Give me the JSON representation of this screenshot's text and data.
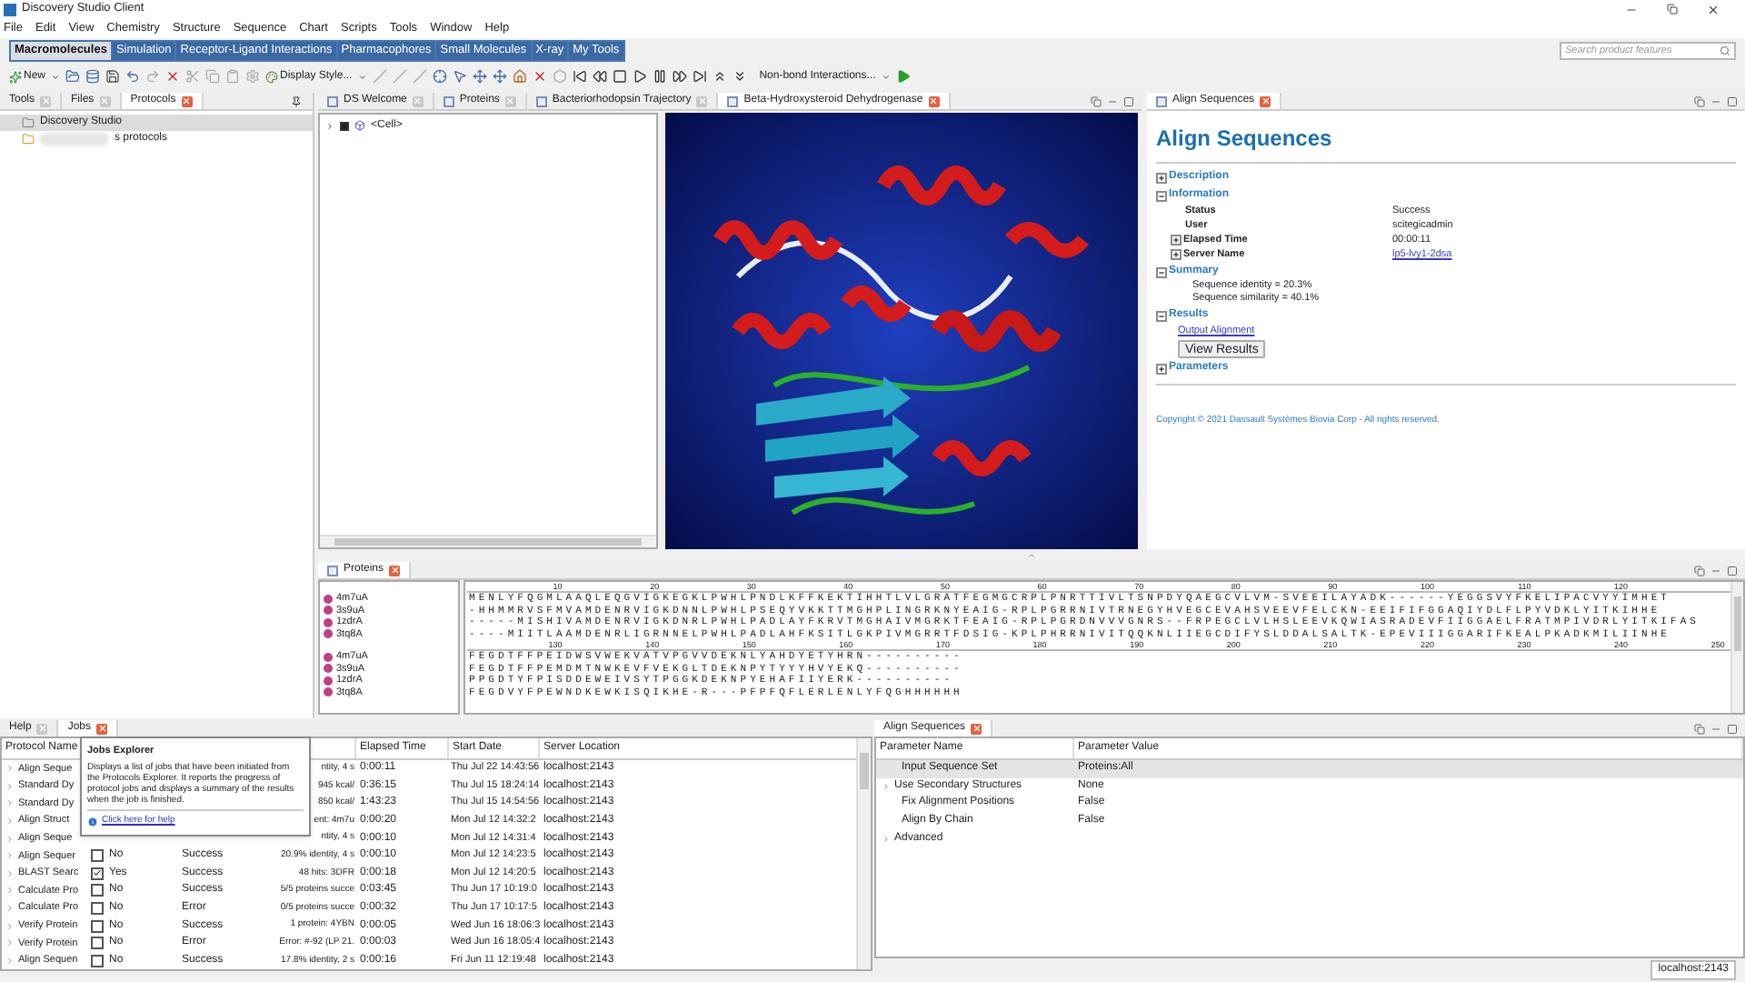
{
  "window": {
    "title": "Discovery Studio Client"
  },
  "menu": [
    "File",
    "Edit",
    "View",
    "Chemistry",
    "Structure",
    "Sequence",
    "Chart",
    "Scripts",
    "Tools",
    "Window",
    "Help"
  ],
  "ribbon_tabs": [
    {
      "label": "Macromolecules",
      "selected": true
    },
    {
      "label": "Simulation",
      "selected": false
    },
    {
      "label": "Receptor-Ligand Interactions",
      "selected": false
    },
    {
      "label": "Pharmacophores",
      "selected": false
    },
    {
      "label": "Small Molecules",
      "selected": false
    },
    {
      "label": "X-ray",
      "selected": false
    },
    {
      "label": "My Tools",
      "selected": false
    }
  ],
  "search": {
    "placeholder": "Search product features"
  },
  "toolbar": {
    "new_label": "New",
    "display_style": "Display Style...",
    "interactions": "Non-bond Interactions..."
  },
  "left_tabs": [
    {
      "label": "Tools",
      "selected": false
    },
    {
      "label": "Files",
      "selected": false
    },
    {
      "label": "Protocols",
      "selected": true
    }
  ],
  "protocol_tree": [
    {
      "label": "Discovery Studio",
      "selected": true,
      "redacted": false
    },
    {
      "label": "s protocols",
      "selected": false,
      "redacted": true
    }
  ],
  "doc_tabs": [
    {
      "label": "DS Welcome",
      "selected": false
    },
    {
      "label": "Proteins",
      "selected": false
    },
    {
      "label": "Bacteriorhodopsin Trajectory",
      "selected": false
    },
    {
      "label": "Beta-Hydroxysteroid Dehydrogenase",
      "selected": true
    }
  ],
  "hierarchy": [
    {
      "label": "<Cell>",
      "expanded": false,
      "visible": true
    }
  ],
  "report_tab": {
    "label": "Align Sequences",
    "selected": true
  },
  "report": {
    "title": "Align Sequences",
    "sections": [
      {
        "label": "Description",
        "expanded": false
      },
      {
        "label": "Information",
        "expanded": true,
        "kind": "fields",
        "fields": [
          {
            "label": "Status",
            "value": "Success",
            "expandable": false,
            "link": false
          },
          {
            "label": "User",
            "value": "scitegicadmin",
            "expandable": false,
            "link": false
          },
          {
            "label": "Elapsed Time",
            "value": "00:00:11",
            "expandable": true,
            "link": false
          },
          {
            "label": "Server Name",
            "value": "lp5-lvy1-2dsa",
            "expandable": true,
            "link": true
          }
        ]
      },
      {
        "label": "Summary",
        "expanded": true,
        "kind": "lines",
        "lines": [
          "Sequence identity = 20.3%",
          "Sequence similarity = 40.1%"
        ]
      },
      {
        "label": "Results",
        "expanded": true,
        "kind": "actions",
        "link": "Output Alignment",
        "button": "View Results"
      },
      {
        "label": "Parameters",
        "expanded": false
      }
    ],
    "copyright": "Copyright © 2021 Dassault Systèmes Biovia Corp - All rights reserved."
  },
  "sequence_panel": {
    "tab": {
      "label": "Proteins",
      "selected": true
    },
    "blocks": [
      {
        "ruler": [
          "10",
          "20",
          "30",
          "40",
          "50",
          "60",
          "70",
          "80",
          "90",
          "100",
          "110",
          "120"
        ],
        "rows": [
          {
            "name": "4m7uA",
            "sequence": "MENLYFQGMLAAQLEQGVIGKEGKLPWHLPNDLKFFKEKTIHHTLVLGRATFEGMGCRPLPNRTTIVLTSNPDYQAEGCVLVM-SVEEILAYADK------YEGGSVYFKELIPACVYYIMHET"
          },
          {
            "name": "3s9uA",
            "sequence": "-HHMMRVSFMVAMDENRVIGKDNNLPWHLPSEQYVKKTTMGHPLINGRKNYEAIG-RPLPGRRNIVTRNEGYHVEGCEVAHSVEEVFELCKN-EEIFIFGGAQIYDLFLPYVDKLYITKIHHE"
          },
          {
            "name": "1zdrA",
            "sequence": "-----MISHIVAMDENRVIGKDNRLPWHLPADLAYFKRVTMGHAIVMGRKTFEAIG-RPLPGRDNVVVGNRS--FRPEGCLVLHSLEEVKQWIASRADEVFIIGGAELFRATMPIVDRLYITKIFAS"
          },
          {
            "name": "3tq8A",
            "sequence": "----MIITLAAMDENRLIGRNNELPWHLPADLAHFKSITLGKPIVMGRRTFDSIG-KPLPHRRNIVITQQKNLIIEGCDIFYSLDDALSALTK-EPEVIIIGGARIFKEALPKADKMILIINHE"
          }
        ]
      },
      {
        "ruler": [
          "130",
          "140",
          "150",
          "160",
          "170",
          "180",
          "190",
          "200",
          "210",
          "220",
          "230",
          "240",
          "250"
        ],
        "rows": [
          {
            "name": "4m7uA",
            "sequence": "FEGDTFFPEIDWSVWEKVATVPGVVDEKNLYAHDYETYHRN----------"
          },
          {
            "name": "3s9uA",
            "sequence": "FEGDTFFPEMDMTNWKEVFVEKGLTDEKNPYTYYYHVYEKQ----------"
          },
          {
            "name": "1zdrA",
            "sequence": "PPGDTYFPISDDEWEIVSYTPGGKDEKNPYEHAFIIYERK----------"
          },
          {
            "name": "3tq8A",
            "sequence": "FEGDVYFPEWNDKEWKISQIKHE-R---PFPFQFLERLENLYFQGHHHHHH"
          }
        ]
      }
    ]
  },
  "bottom_tabs": [
    {
      "label": "Help",
      "selected": false
    },
    {
      "label": "Jobs",
      "selected": true
    }
  ],
  "jobs": {
    "columns": [
      "Protocol Name",
      "Elapsed Time",
      "Start Date",
      "Server Location"
    ],
    "rows": [
      {
        "name": "Align Seque",
        "summary": "ntity, 4 s",
        "elapsed": "0:00:11",
        "start": "Thu Jul 22 14:43:56",
        "server": "localhost:2143"
      },
      {
        "name": "Standard Dy",
        "summary": "945 kcal/",
        "elapsed": "0:36:15",
        "start": "Thu Jul 15 18:24:14",
        "server": "localhost:2143"
      },
      {
        "name": "Standard Dy",
        "summary": "850 kcal/",
        "elapsed": "1:43:23",
        "start": "Thu Jul 15 14:54:56",
        "server": "localhost:2143"
      },
      {
        "name": "Align Struct",
        "summary": "ent: 4m7u",
        "elapsed": "0:00:20",
        "start": "Mon Jul 12 14:32:2",
        "server": "localhost:2143"
      },
      {
        "name": "Align Seque",
        "summary": "ntity, 4 s",
        "elapsed": "0:00:10",
        "start": "Mon Jul 12 14:31:4",
        "server": "localhost:2143"
      },
      {
        "name": "Align Sequer",
        "flag": {
          "label": "No",
          "checked": false
        },
        "status": "Success",
        "summary": "20.9% identity, 4 s",
        "elapsed": "0:00:10",
        "start": "Mon Jul 12 14:23:5",
        "server": "localhost:2143"
      },
      {
        "name": "BLAST Searc",
        "flag": {
          "label": "Yes",
          "checked": true
        },
        "status": "Success",
        "summary": "48 hits: 3DFR",
        "elapsed": "0:00:18",
        "start": "Mon Jul 12 14:20:5",
        "server": "localhost:2143"
      },
      {
        "name": "Calculate Pro",
        "flag": {
          "label": "No",
          "checked": false
        },
        "status": "Success",
        "summary": "5/5 proteins succe",
        "elapsed": "0:03:45",
        "start": "Thu Jun 17 10:19:0",
        "server": "localhost:2143"
      },
      {
        "name": "Calculate Pro",
        "flag": {
          "label": "No",
          "checked": false
        },
        "status": "Error",
        "summary": "0/5 proteins succe",
        "elapsed": "0:00:32",
        "start": "Thu Jun 17 10:17:5",
        "server": "localhost:2143"
      },
      {
        "name": "Verify Protein",
        "flag": {
          "label": "No",
          "checked": false
        },
        "status": "Success",
        "summary": "1 protein: 4YBN",
        "elapsed": "0:00:05",
        "start": "Wed Jun 16 18:06:3",
        "server": "localhost:2143"
      },
      {
        "name": "Verify Protein",
        "flag": {
          "label": "No",
          "checked": false
        },
        "status": "Error",
        "summary": "Error: #-92 (LP 21.",
        "elapsed": "0:00:03",
        "start": "Wed Jun 16 18:05:4",
        "server": "localhost:2143"
      },
      {
        "name": "Align Sequen",
        "flag": {
          "label": "No",
          "checked": false
        },
        "status": "Success",
        "summary": "17.8% identity, 2 s",
        "elapsed": "0:00:16",
        "start": "Fri Jun 11 12:19:48",
        "server": "localhost:2143"
      }
    ]
  },
  "tooltip": {
    "title": "Jobs Explorer",
    "body": "Displays a list of jobs that have been initiated from the Protocols Explorer. It reports the progress of protocol jobs and displays a summary of the results when the job is finished.",
    "link": "Click here for help"
  },
  "params_tab": {
    "label": "Align Sequences",
    "selected": true
  },
  "params": {
    "columns": [
      "Parameter Name",
      "Parameter Value"
    ],
    "rows": [
      {
        "name": "Input Sequence Set",
        "value": "Proteins:All",
        "expandable": false,
        "selected": true
      },
      {
        "name": "Use Secondary Structures",
        "value": "None",
        "expandable": true,
        "selected": false
      },
      {
        "name": "Fix Alignment Positions",
        "value": "False",
        "expandable": false,
        "selected": false
      },
      {
        "name": "Align By Chain",
        "value": "False",
        "expandable": false,
        "selected": false
      },
      {
        "name": "Advanced",
        "expandable": true,
        "selected": false
      }
    ]
  },
  "status_bar": "localhost:2143"
}
